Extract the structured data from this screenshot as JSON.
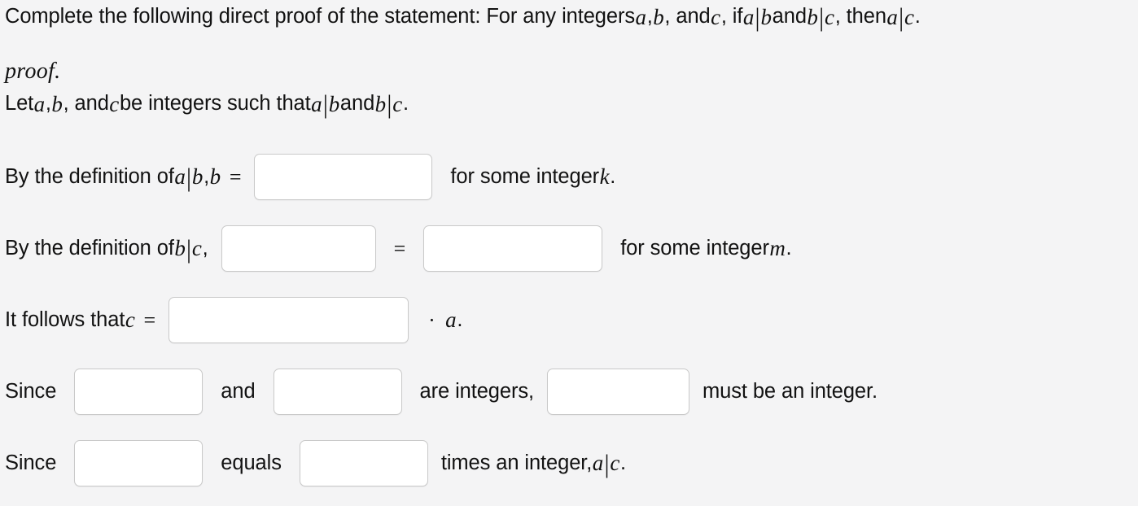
{
  "page": {
    "background_color": "#f4f4f5",
    "text_color": "#121212"
  },
  "prompt": {
    "lead": "Complete the following direct proof of the statement: For any integers ",
    "var_a": "a",
    "comma1": ", ",
    "var_b": "b",
    "comma2": ", and ",
    "var_c": "c",
    "if_text": ", if ",
    "div_ab_a": "a",
    "div_bar1": "|",
    "div_ab_b": "b",
    "and_text": " and ",
    "div_bc_b": "b",
    "div_bar2": "|",
    "div_bc_c": "c",
    "then_text": ", then ",
    "div_ac_a": "a",
    "div_bar3": "|",
    "div_ac_c": "c",
    "period": "."
  },
  "proof": {
    "heading": "proof.",
    "line_let": {
      "t1": "Let ",
      "a": "a",
      "t2": ", ",
      "b": "b",
      "t3": ", and ",
      "c": "c",
      "t4": " be integers such that ",
      "ab_a": "a",
      "bar1": "|",
      "ab_b": "b",
      "t5": " and ",
      "bc_b": "b",
      "bar2": "|",
      "bc_c": "c",
      "t6": "."
    },
    "line_def_ab": {
      "t1": "By the definition of ",
      "a": "a",
      "bar": "|",
      "b": "b",
      "t2": ", ",
      "b2": "b",
      "equals": "=",
      "blank1_value": "",
      "blank1_placeholder": "",
      "t3": "for some integer ",
      "k": "k",
      "t4": "."
    },
    "line_def_bc": {
      "t1": "By the definition of ",
      "b": "b",
      "bar": "|",
      "c": "c",
      "t2": ",",
      "blank1_value": "",
      "blank1_placeholder": "",
      "equals": "=",
      "blank2_value": "",
      "blank2_placeholder": "",
      "t3": "for some integer ",
      "m": "m",
      "t4": "."
    },
    "line_follows": {
      "t1": "It follows that ",
      "c": "c",
      "equals": "=",
      "blank1_value": "",
      "blank1_placeholder": "",
      "dot": "·",
      "a": "a",
      "t2": "."
    },
    "line_since_integers": {
      "t1": "Since",
      "blank1_value": "",
      "blank1_placeholder": "",
      "t2": "and",
      "blank2_value": "",
      "blank2_placeholder": "",
      "t3": "are integers,",
      "blank3_value": "",
      "blank3_placeholder": "",
      "t4": "must be an integer."
    },
    "line_since_equals": {
      "t1": "Since",
      "blank1_value": "",
      "blank1_placeholder": "",
      "t2": "equals",
      "blank2_value": "",
      "blank2_placeholder": "",
      "t3": "times an integer, ",
      "a": "a",
      "bar": "|",
      "c": "c",
      "t4": "."
    }
  }
}
